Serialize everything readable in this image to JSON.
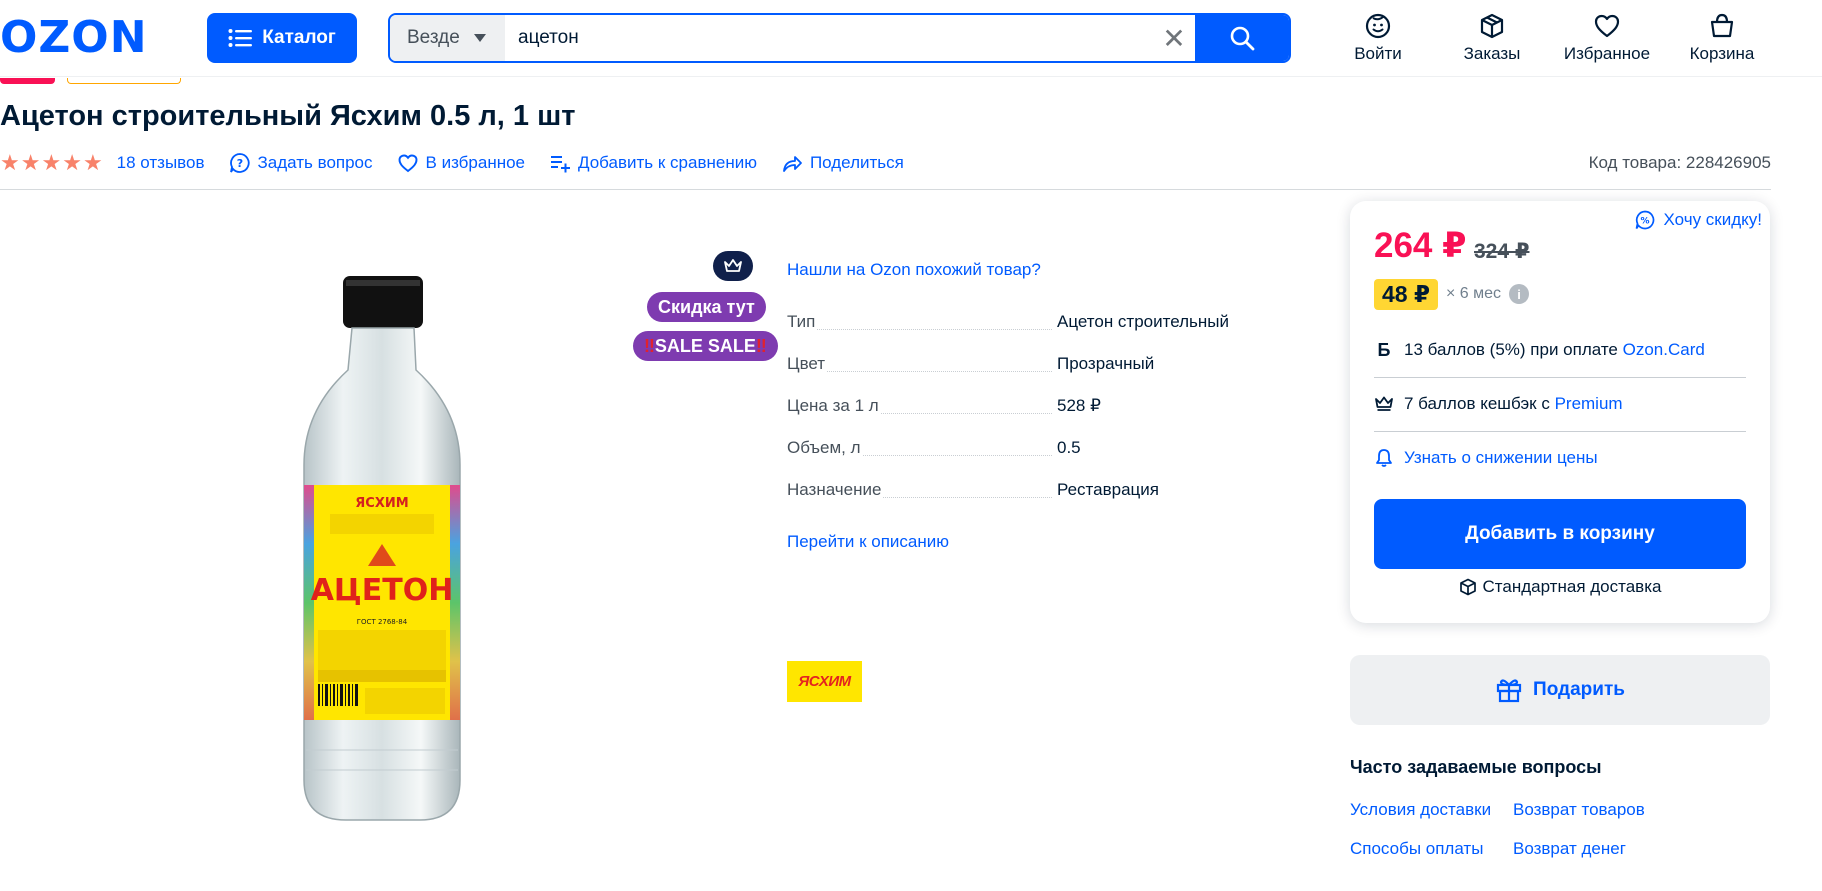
{
  "header": {
    "logo": "OZON",
    "catalog_label": "Каталог",
    "search_scope": "Везде",
    "search_value": "ацетон",
    "nav": [
      "Войти",
      "Заказы",
      "Избранное",
      "Корзина"
    ]
  },
  "product": {
    "title": "Ацетон строительный Ясхим 0.5 л, 1 шт",
    "rating_stars": 5,
    "reviews": "18 отзывов",
    "ask_question": "Задать вопрос",
    "favorite": "В избранное",
    "compare": "Добавить к сравнению",
    "share": "Поделиться",
    "sku": "Код товара: 228426905",
    "badges": {
      "discount_here": "Скидка тут",
      "sale_prefix": "‼",
      "sale_text": "SALE SALE",
      "sale_suffix": "‼"
    },
    "similar_link": "Нашли на Ozon похожий товар?",
    "characteristics": [
      {
        "name": "Тип",
        "value": "Ацетон строительный"
      },
      {
        "name": "Цвет",
        "value": "Прозрачный"
      },
      {
        "name": "Цена за 1 л",
        "value": "528 ₽"
      },
      {
        "name": "Объем, л",
        "value": "0.5"
      },
      {
        "name": "Назначение",
        "value": "Реставрация"
      }
    ],
    "goto_description": "Перейти к описанию",
    "brand_logo_text": "ЯСХИМ",
    "label": {
      "brand": "ЯСХИМ",
      "product_name": "АЦЕТОН",
      "gost": "ГОСТ 2768-84"
    }
  },
  "buybox": {
    "want_discount": "Хочу скидку!",
    "price": "264 ₽",
    "old_price": "324 ₽",
    "installment_amount": "48 ₽",
    "installment_term": "× 6 мес",
    "points_icon": "Б",
    "points_text": "13 баллов (5%) при оплате",
    "points_link": "Ozon.Card",
    "cashback_text": "7 баллов кешбэк с",
    "cashback_link": "Premium",
    "price_drop": "Узнать о снижении цены",
    "add_to_cart": "Добавить в корзину",
    "delivery": "Стандартная доставка"
  },
  "gift": "Подарить",
  "faq": {
    "title": "Часто задаваемые вопросы",
    "links": [
      "Условия доставки",
      "Возврат товаров",
      "Способы оплаты",
      "Возврат денег"
    ]
  },
  "colors": {
    "brand_blue": "#005bff",
    "price_red": "#f91155",
    "star": "#f8826a",
    "badge_purple": "#7e3bb0",
    "installment_yellow": "#ffd633"
  }
}
